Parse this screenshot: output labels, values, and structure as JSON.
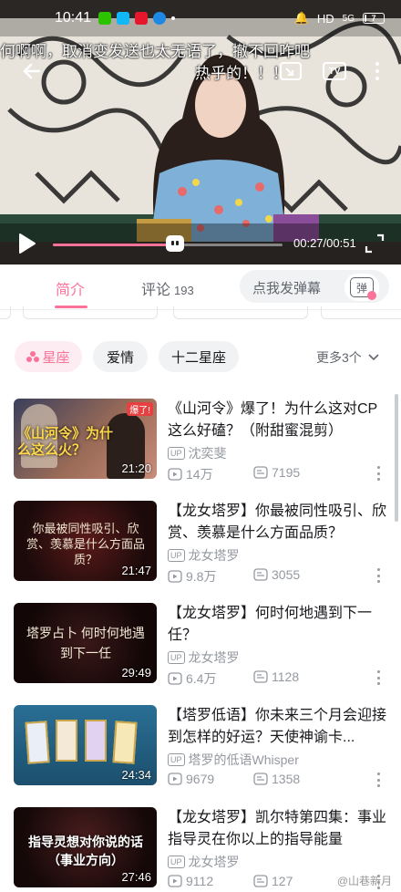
{
  "status_bar": {
    "time": "10:41",
    "network": "HD",
    "signal": "5G",
    "battery": "7"
  },
  "player": {
    "danmaku": [
      "何啊啊，取消变发送也太无语了，撤不回咋吧",
      "热乎的！！！"
    ],
    "current_time": "00:27",
    "duration": "00:51",
    "progress": 0.53,
    "cast_label": "TV"
  },
  "tabs": {
    "intro_label": "简介",
    "comments_label": "评论",
    "comments_count": "193",
    "danmaku_placeholder": "点我发弹幕",
    "danmaku_toggle_label": "弹"
  },
  "tags": [
    {
      "label": "星座",
      "active": true
    },
    {
      "label": "爱情",
      "active": false
    },
    {
      "label": "十二星座",
      "active": false
    }
  ],
  "more_tags_label": "更多3个",
  "videos": [
    {
      "title": "《山河令》爆了！为什么这对CP这么好磕？（附甜蜜混剪）",
      "uploader": "沈奕斐",
      "views": "14万",
      "danmaku": "7195",
      "duration": "21:20",
      "cover_text": "《山河令》为什么这么火？",
      "cover_tag": "爆了!",
      "up_badge": "UP"
    },
    {
      "title": "【龙女塔罗】你最被同性吸引、欣赏、羡慕是什么方面品质？",
      "uploader": "龙女塔罗",
      "views": "9.8万",
      "danmaku": "3055",
      "duration": "21:47",
      "cover_text": "你最被同性吸引、欣赏、羡慕是什么方面品质？",
      "up_badge": "UP"
    },
    {
      "title": "【龙女塔罗】何时何地遇到下一任？",
      "uploader": "龙女塔罗",
      "views": "6.4万",
      "danmaku": "1128",
      "duration": "29:49",
      "cover_text": "塔罗占卜 何时何地遇到下一任",
      "up_badge": "UP"
    },
    {
      "title": "【塔罗低语】你未来三个月会迎接到怎样的好运？天使神谕卡...",
      "uploader": "塔罗的低语Whisper",
      "views": "9679",
      "danmaku": "1358",
      "duration": "24:34",
      "up_badge": "UP"
    },
    {
      "title": "【龙女塔罗】凯尔特第四集：事业指导灵在你以上的指导能量",
      "uploader": "龙女塔罗",
      "views": "9112",
      "danmaku": "127",
      "duration": "27:46",
      "cover_text": "指导灵想对你说的话（事业方向）",
      "up_badge": "UP"
    }
  ],
  "watermark": "@山巷新月",
  "colors": {
    "accent": "#fb7299",
    "text_primary": "#18191c",
    "text_secondary": "#9499a0"
  }
}
